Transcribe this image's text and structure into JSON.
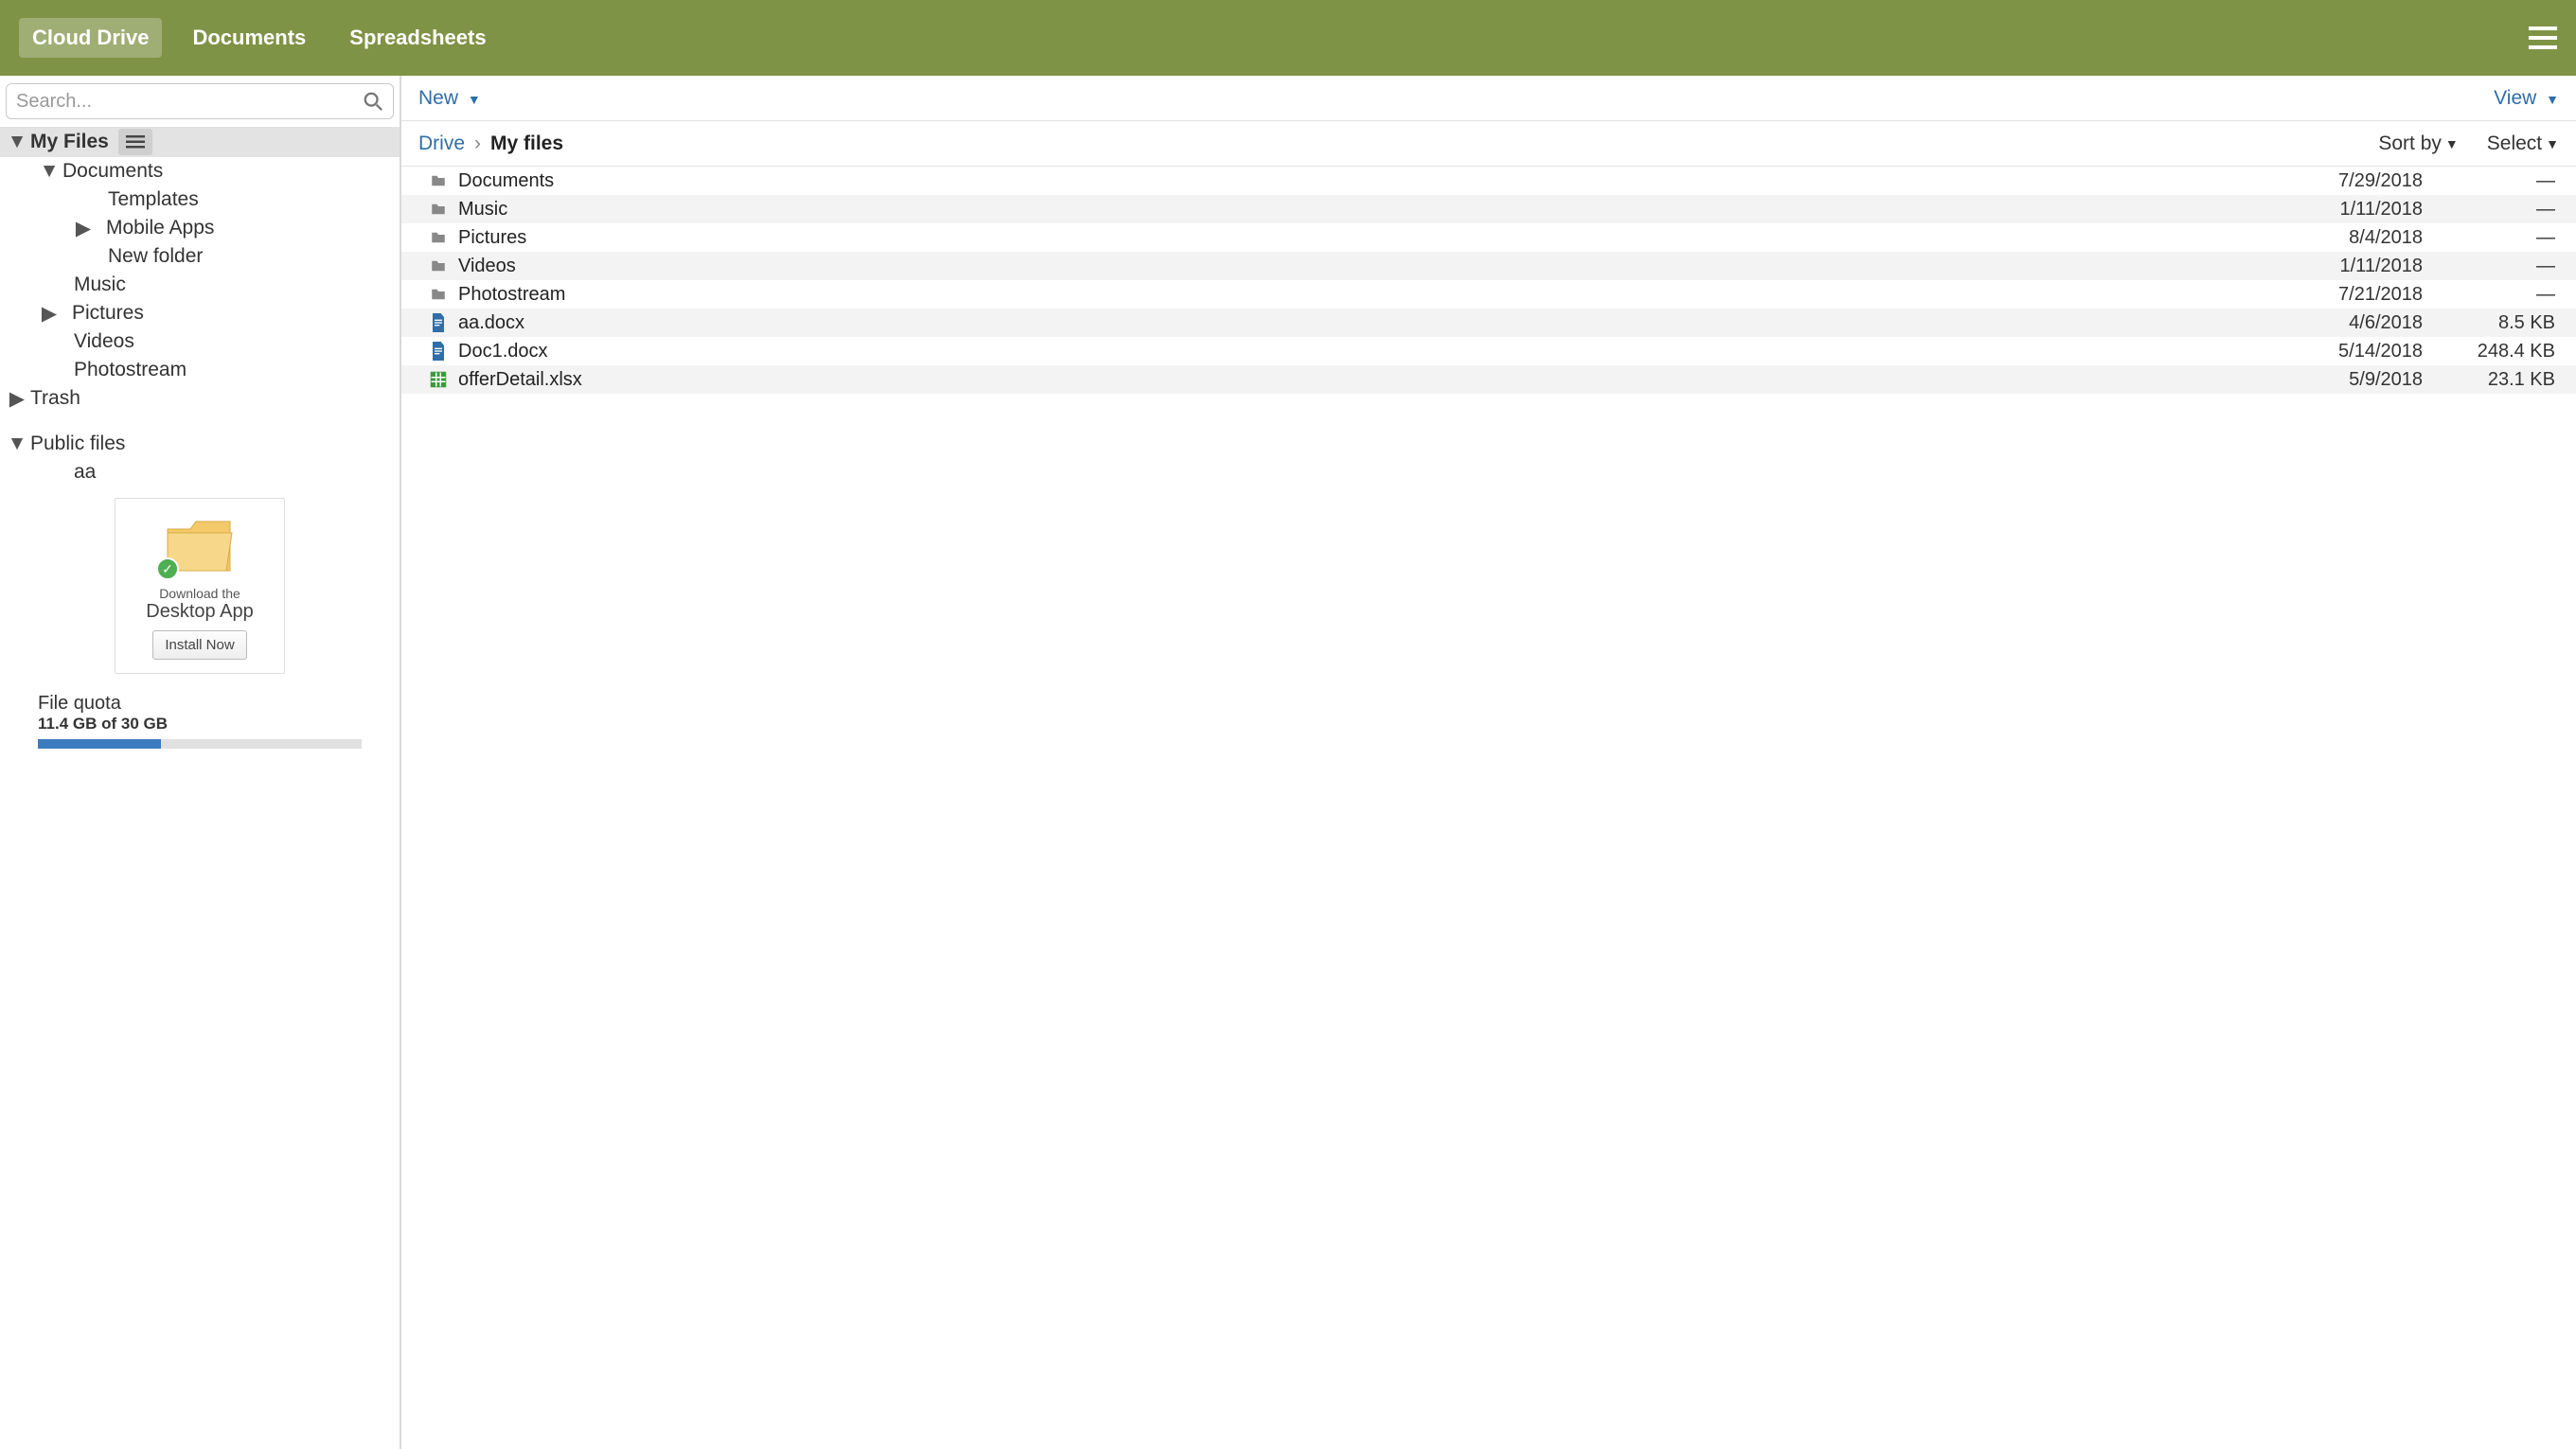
{
  "topbar": {
    "tabs": [
      "Cloud Drive",
      "Documents",
      "Spreadsheets"
    ],
    "active_index": 0
  },
  "sidebar": {
    "search_placeholder": "Search...",
    "roots": {
      "my_files": "My Files",
      "trash": "Trash",
      "public_files": "Public files"
    },
    "my_files_children": {
      "documents": "Documents",
      "templates": "Templates",
      "mobile_apps": "Mobile Apps",
      "new_folder": "New folder",
      "music": "Music",
      "pictures": "Pictures",
      "videos": "Videos",
      "photostream": "Photostream"
    },
    "public_children": {
      "aa": "aa"
    },
    "promo": {
      "line1": "Download the",
      "line2": "Desktop App",
      "button": "Install Now"
    },
    "quota": {
      "label": "File quota",
      "value": "11.4 GB of 30 GB",
      "percent": 38
    }
  },
  "toolbar": {
    "new": "New",
    "view": "View"
  },
  "breadcrumb": {
    "root": "Drive",
    "current": "My files"
  },
  "listhead": {
    "sort_by": "Sort by",
    "select": "Select"
  },
  "files": [
    {
      "icon": "folder",
      "name": "Documents",
      "date": "7/29/2018",
      "size": "—"
    },
    {
      "icon": "folder",
      "name": "Music",
      "date": "1/11/2018",
      "size": "—"
    },
    {
      "icon": "folder",
      "name": "Pictures",
      "date": "8/4/2018",
      "size": "—"
    },
    {
      "icon": "folder",
      "name": "Videos",
      "date": "1/11/2018",
      "size": "—"
    },
    {
      "icon": "folder",
      "name": "Photostream",
      "date": "7/21/2018",
      "size": "—"
    },
    {
      "icon": "doc",
      "name": "aa.docx",
      "date": "4/6/2018",
      "size": "8.5 KB"
    },
    {
      "icon": "doc",
      "name": "Doc1.docx",
      "date": "5/14/2018",
      "size": "248.4 KB"
    },
    {
      "icon": "sheet",
      "name": "offerDetail.xlsx",
      "date": "5/9/2018",
      "size": "23.1 KB"
    }
  ]
}
